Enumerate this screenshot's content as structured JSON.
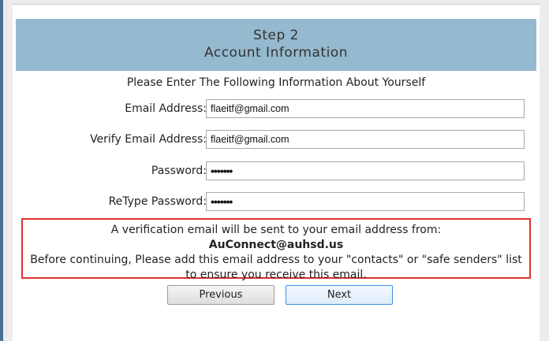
{
  "header": {
    "step": "Step 2",
    "title": "Account Information"
  },
  "intro": "Please Enter The Following Information About Yourself",
  "fields": {
    "email": {
      "label": "Email Address:",
      "value": "flaeitf@gmail.com"
    },
    "verify_email": {
      "label": "Verify Email Address:",
      "value": "flaeitf@gmail.com"
    },
    "password": {
      "label": "Password:",
      "value": "•••••••"
    },
    "retype_password": {
      "label": "ReType Password:",
      "value": "•••••••"
    }
  },
  "notice": {
    "line1": "A verification email will be sent to your email address from:",
    "address": "AuConnect@auhsd.us",
    "line2": "Before continuing, Please add this email address to your \"contacts\" or \"safe senders\" list to ensure you receive this email.",
    "border_color": "#e03030"
  },
  "buttons": {
    "previous": "Previous",
    "next": "Next"
  },
  "colors": {
    "header_bg": "#95b9cf",
    "accent_blue": "#3d8ee6"
  }
}
